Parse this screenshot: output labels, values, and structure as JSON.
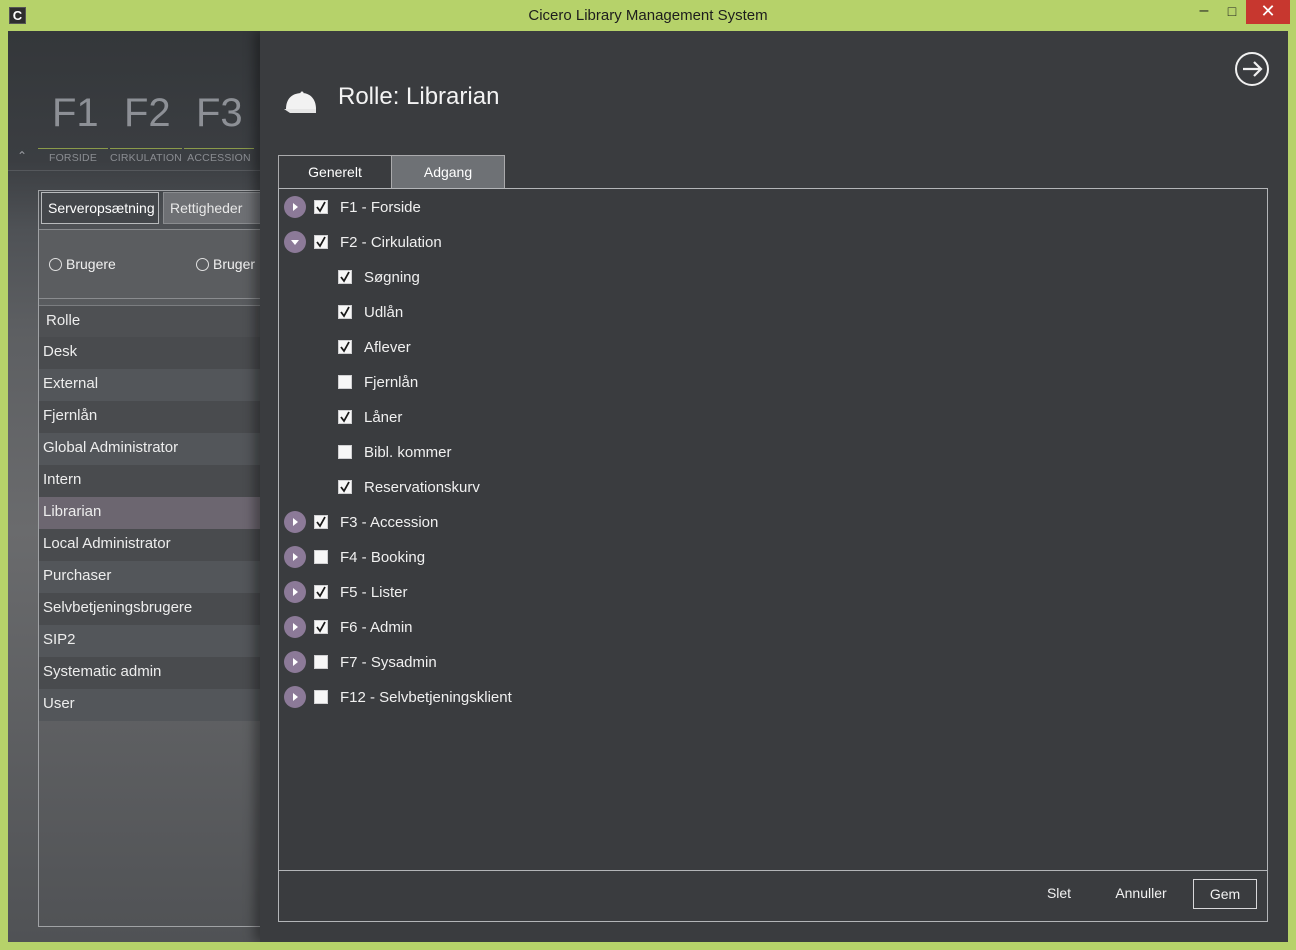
{
  "window": {
    "title": "Cicero Library Management System",
    "icon_letter": "C",
    "minimize_glyph": "–",
    "maximize_glyph": "□",
    "close_glyph": "✕"
  },
  "fkeys": [
    {
      "key": "F1",
      "label": "FORSIDE"
    },
    {
      "key": "F2",
      "label": "CIRKULATION"
    },
    {
      "key": "F3",
      "label": "ACCESSION"
    }
  ],
  "left": {
    "subtabs": [
      "Serveropsætning",
      "Rettigheder"
    ],
    "radios": [
      "Brugere",
      "Bruger"
    ],
    "roles_header": "Rolle",
    "roles": [
      "Desk",
      "External",
      "Fjernlån",
      "Global Administrator",
      "Intern",
      "Librarian",
      "Local Administrator",
      "Purchaser",
      "Selvbetjeningsbrugere",
      "SIP2",
      "Systematic admin",
      "User"
    ],
    "selected_role": "Librarian"
  },
  "dialog": {
    "title": "Rolle: Librarian",
    "tabs": [
      "Generelt",
      "Adgang"
    ],
    "active_tab": "Adgang",
    "tree": [
      {
        "label": "F1 - Forside",
        "checked": true,
        "level": 0,
        "expanded": false
      },
      {
        "label": "F2 - Cirkulation",
        "checked": true,
        "level": 0,
        "expanded": true
      },
      {
        "label": "Søgning",
        "checked": true,
        "level": 1
      },
      {
        "label": "Udlån",
        "checked": true,
        "level": 1
      },
      {
        "label": "Aflever",
        "checked": true,
        "level": 1
      },
      {
        "label": "Fjernlån",
        "checked": false,
        "level": 1
      },
      {
        "label": "Låner",
        "checked": true,
        "level": 1
      },
      {
        "label": "Bibl. kommer",
        "checked": false,
        "level": 1
      },
      {
        "label": "Reservationskurv",
        "checked": true,
        "level": 1
      },
      {
        "label": "F3 - Accession",
        "checked": true,
        "level": 0,
        "expanded": false
      },
      {
        "label": "F4 - Booking",
        "checked": false,
        "level": 0,
        "expanded": false
      },
      {
        "label": "F5 - Lister",
        "checked": true,
        "level": 0,
        "expanded": false
      },
      {
        "label": "F6 - Admin",
        "checked": true,
        "level": 0,
        "expanded": false
      },
      {
        "label": "F7 - Sysadmin",
        "checked": false,
        "level": 0,
        "expanded": false
      },
      {
        "label": "F12 - Selvbetjeningsklient",
        "checked": false,
        "level": 0,
        "expanded": false
      }
    ],
    "buttons": {
      "delete": "Slet",
      "cancel": "Annuller",
      "save": "Gem"
    }
  },
  "colors": {
    "accent": "#8c7a98",
    "chrome": "#b6d26a",
    "close": "#c7372f"
  }
}
